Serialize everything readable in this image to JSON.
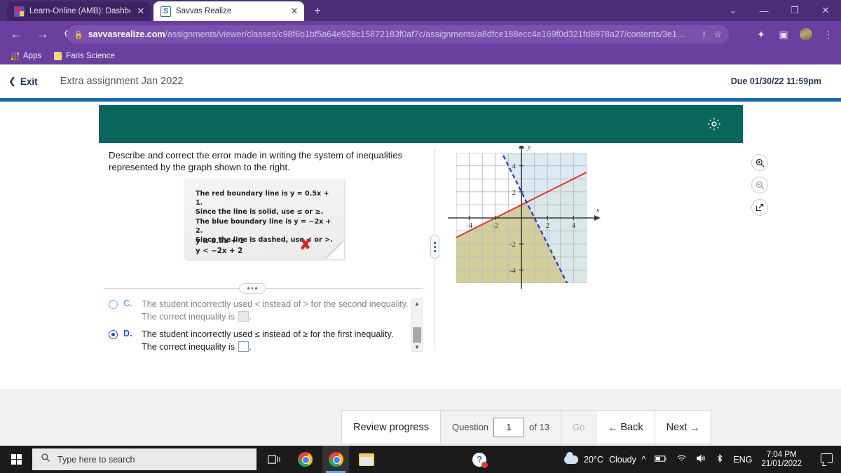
{
  "browser": {
    "tabs": [
      {
        "title": "Learn-Online (AMB): Dashboard (",
        "favicon": "teams-icon",
        "active": false
      },
      {
        "title": "Savvas Realize",
        "favicon": "savvas-icon",
        "active": true
      }
    ],
    "new_tab_label": "+",
    "window_controls": [
      "chevron-down-icon",
      "minimize-icon",
      "restore-icon",
      "close-icon"
    ],
    "nav": {
      "back": "←",
      "forward": "→",
      "reload": "⟳"
    },
    "url_host": "savvasrealize.com",
    "url_path": "/assignments/viewer/classes/c98f6b1bf5a64e928c15872183f0af7c/assignments/a8dfce188ecc4e169f0d321fd8978a27/contents/3e1…",
    "omni_icons": [
      "share-icon",
      "bookmark-star-icon"
    ],
    "toolbar_icons": [
      "extensions-puzzle-icon",
      "sidepanel-icon",
      "profile-avatar",
      "kebab-menu-icon"
    ],
    "bookmarks": [
      {
        "label": "Apps",
        "icon": "apps-grid-icon"
      },
      {
        "label": "Faris Science",
        "icon": "folder-icon"
      }
    ]
  },
  "app_header": {
    "exit_label": "Exit",
    "exit_icon": "chevron-left-icon",
    "assignment_title": "Extra assignment Jan 2022",
    "due_text": "Due 01/30/22 11:59pm"
  },
  "question_panel": {
    "settings_icon": "gear-icon",
    "prompt": "Describe and correct the error made in writing the system of inequalities represented by the graph shown to the right.",
    "note": {
      "lines": [
        "The red boundary line is y = 0.5x + 1.",
        "Since the line is solid, use ≤ or ≥.",
        "The blue boundary line is y = −2x + 2.",
        "Since the line is dashed, use < or >."
      ],
      "equations": [
        "y ≤ 0.5x + 1",
        "y < −2x + 2"
      ],
      "mark": "✘",
      "mark_color": "#d3262b"
    },
    "choices": [
      {
        "letter": "C.",
        "selected": false,
        "text_before": "The student incorrectly used  <  instead of  >  for the second inequality. The correct inequality is",
        "text_after": ".",
        "answer_box": "filled"
      },
      {
        "letter": "D.",
        "selected": true,
        "text_before": "The student incorrectly used  ≤  instead of  ≥  for the first inequality. The correct inequality is",
        "text_after": ".",
        "answer_box": "empty"
      }
    ],
    "expand_dots": "•••",
    "drag_handle": "drag-handle"
  },
  "graph_tools": [
    {
      "name": "zoom-in-icon",
      "glyph": "⊕"
    },
    {
      "name": "zoom-out-icon",
      "glyph": "⊖"
    },
    {
      "name": "expand-icon",
      "glyph": "↗"
    }
  ],
  "chart_data": {
    "type": "line",
    "title": "",
    "xlabel": "x",
    "ylabel": "y",
    "xlim": [
      -5,
      5
    ],
    "ylim": [
      -5,
      5
    ],
    "xticks": [
      -4,
      -2,
      2,
      4
    ],
    "yticks": [
      -4,
      -2,
      2,
      4
    ],
    "grid": true,
    "series": [
      {
        "name": "red boundary line",
        "equation": "y = 0.5x + 1",
        "slope": 0.5,
        "intercept": 1,
        "color": "#e2352c",
        "style": "solid",
        "shade": "below",
        "shade_color": "#faf3cc"
      },
      {
        "name": "blue boundary line",
        "equation": "y = -2x + 2",
        "slope": -2,
        "intercept": 2,
        "color": "#2535c8",
        "style": "dashed",
        "shade": "right",
        "shade_color": "#cfe2f0"
      }
    ],
    "annotations": [
      "overlap region shaded olive-green"
    ]
  },
  "bottom_nav": {
    "review_label": "Review progress",
    "question_label": "Question",
    "question_value": "1",
    "of_label": "of 13",
    "go_label": "Go",
    "back_label": "Back",
    "back_icon": "←",
    "next_label": "Next",
    "next_icon": "→"
  },
  "taskbar": {
    "start_icon": "windows-logo-icon",
    "search_placeholder": "Type here to search",
    "search_icon": "search-icon",
    "pinned": [
      "task-view-icon",
      "chrome-icon",
      "chrome-active-icon",
      "file-explorer-icon"
    ],
    "notification_icon": "help-badge-icon",
    "weather_temp": "20°C",
    "weather_desc": "Cloudy",
    "tray_icons": [
      "chevron-up-icon",
      "battery-icon",
      "wifi-icon",
      "volume-icon",
      "bluetooth-icon"
    ],
    "language": "ENG",
    "time": "7:04 PM",
    "date": "21/01/2022",
    "action_center_icon": "action-center-icon"
  }
}
